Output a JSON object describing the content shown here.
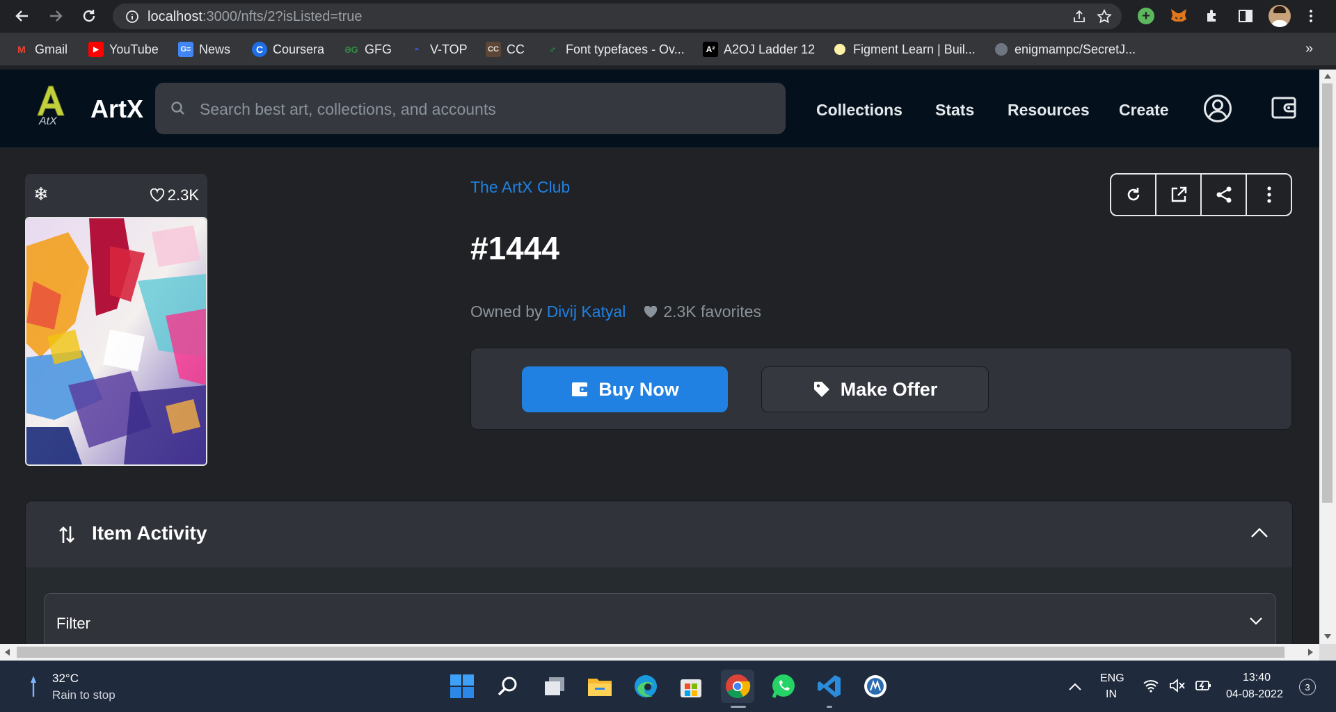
{
  "browser": {
    "url_host": "localhost",
    "url_path": ":3000/nfts/2?isListed=true",
    "bookmarks": [
      {
        "label": "Gmail",
        "icon": "gmail-icon",
        "color": "#ea4335"
      },
      {
        "label": "YouTube",
        "icon": "youtube-icon",
        "color": "#ff0000"
      },
      {
        "label": "News",
        "icon": "news-icon",
        "color": "#4285f4"
      },
      {
        "label": "Coursera",
        "icon": "coursera-icon",
        "color": "#1f6ee6"
      },
      {
        "label": "GFG",
        "icon": "gfg-icon",
        "color": "#2f8d46"
      },
      {
        "label": "V-TOP",
        "icon": "vtop-icon",
        "color": "#2a3b8f"
      },
      {
        "label": "CC",
        "icon": "codechef-icon",
        "color": "#5b4638"
      },
      {
        "label": "Font typefaces - Ov...",
        "icon": "font-icon",
        "color": "#1db954"
      },
      {
        "label": "A2OJ Ladder 12",
        "icon": "a2oj-icon",
        "color": "#000000"
      },
      {
        "label": "Figment Learn | Buil...",
        "icon": "figment-icon",
        "color": "#fff1a8"
      },
      {
        "label": "enigmampc/SecretJ...",
        "icon": "github-icon",
        "color": "#6e7681"
      }
    ]
  },
  "site": {
    "brand": "ArtX",
    "logo_text": "A",
    "logo_sub": "AtX",
    "search_placeholder": "Search best art, collections, and accounts",
    "nav": [
      "Collections",
      "Stats",
      "Resources",
      "Create"
    ]
  },
  "nft": {
    "likes": "2.3K",
    "collection": "The ArtX Club",
    "token": "#1444",
    "owned_by_label": "Owned by",
    "owner": "Divij Katyal",
    "favorites": "2.3K favorites",
    "buy_label": "Buy Now",
    "offer_label": "Make Offer"
  },
  "activity": {
    "title": "Item Activity",
    "filter_label": "Filter"
  },
  "taskbar": {
    "temperature": "32°C",
    "weather": "Rain to stop",
    "lang_line1": "ENG",
    "lang_line2": "IN",
    "time": "13:40",
    "date": "04-08-2022",
    "notifications": "3"
  },
  "colors": {
    "accent": "#2081e2",
    "header_bg": "#04111d",
    "page_bg": "#202225"
  }
}
